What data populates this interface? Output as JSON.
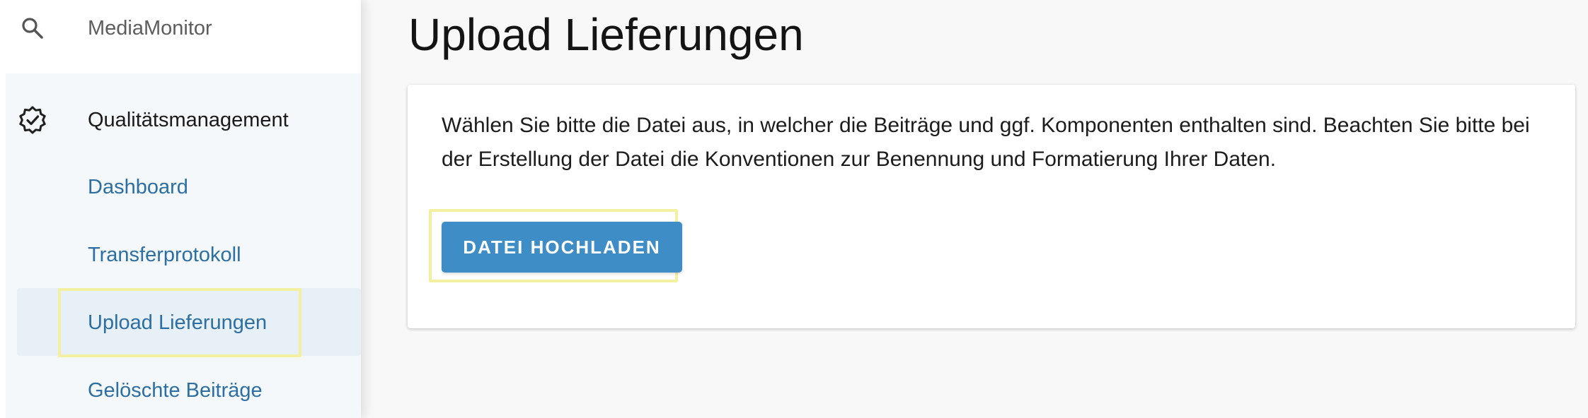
{
  "sidebar": {
    "search": {
      "label": "MediaMonitor",
      "icon": "search-icon"
    },
    "section": {
      "label": "Qualitätsmanagement",
      "icon": "verified-badge-icon"
    },
    "items": [
      {
        "label": "Dashboard",
        "active": false
      },
      {
        "label": "Transferprotokoll",
        "active": false
      },
      {
        "label": "Upload Lieferungen",
        "active": true
      },
      {
        "label": "Gelöschte Beiträge",
        "active": false
      }
    ]
  },
  "main": {
    "title": "Upload Lieferungen",
    "card": {
      "description": "Wählen Sie bitte die Datei aus, in welcher die Beiträge und ggf. Komponenten enthalten sind. Beachten Sie bitte bei der Erstellung der Datei die Konventionen zur Benennung und Formatierung Ihrer Daten.",
      "upload_button_label": "DATEI HOCHLADEN"
    }
  },
  "colors": {
    "accent": "#3f8dc6",
    "link": "#2d6fa3",
    "highlight": "#f3f0a2",
    "active_bg": "#e7f0f7"
  }
}
